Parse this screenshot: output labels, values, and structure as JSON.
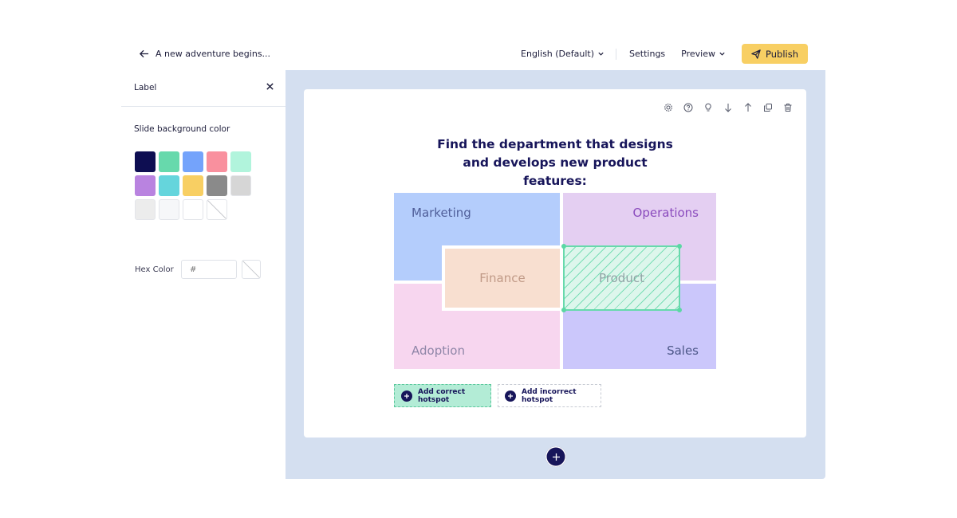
{
  "topbar": {
    "back_label": "A new adventure begins...",
    "language": "English (Default)",
    "settings": "Settings",
    "preview": "Preview",
    "publish": "Publish",
    "publish_color": "#f8cf63"
  },
  "sidebar": {
    "title": "Label",
    "section_title": "Slide background color",
    "swatches": [
      "#0e0e52",
      "#67d9ac",
      "#74a3fb",
      "#f9909e",
      "#b1f4dc",
      "#b983e0",
      "#65d5dc",
      "#f8cf63",
      "#8a8a8a",
      "#d6d6d6",
      "#ececec",
      "#f6f7f9",
      "#ffffff",
      "none"
    ],
    "hex_label": "Hex Color",
    "hex_placeholder": "#"
  },
  "slide": {
    "question": "Find the department that designs and develops new product features:",
    "tools": [
      "gear-icon",
      "help-icon",
      "lightbulb-icon",
      "arrow-down-icon",
      "arrow-up-icon",
      "duplicate-icon",
      "trash-icon"
    ],
    "image": {
      "marketing": "Marketing",
      "operations": "Operations",
      "finance": "Finance",
      "adoption": "Adoption",
      "sales": "Sales",
      "product": "Product"
    },
    "add_correct": "Add correct hotspot",
    "add_incorrect": "Add incorrect hotspot"
  }
}
